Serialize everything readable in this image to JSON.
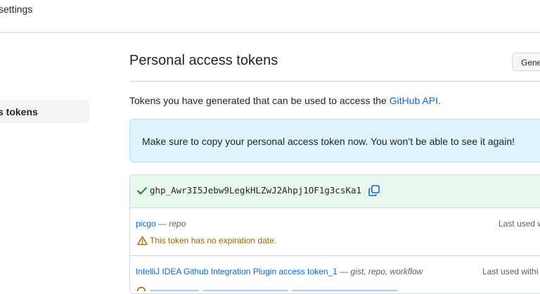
{
  "topbar": {
    "crumb": "settings"
  },
  "sidebar": {
    "active_item": "s tokens"
  },
  "page": {
    "title": "Personal access tokens",
    "generate_button": "Gene",
    "description_prefix": "Tokens you have generated that can be used to access the ",
    "description_link": "GitHub API",
    "description_suffix": "."
  },
  "flash": {
    "message": "Make sure to copy your personal access token now. You won’t be able to see it again!"
  },
  "new_token": {
    "value": "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"
  },
  "tokens": [
    {
      "name": "picgo",
      "scopes": " — repo",
      "last_used": "Last used w",
      "warning": "This token has no expiration date."
    },
    {
      "name": "IntelliJ IDEA Github Integration Plugin access token_1",
      "scopes": " — gist, repo, workflow",
      "last_used": "Last used withi"
    }
  ],
  "colors": {
    "link": "#0969da",
    "flash_bg": "#ddf4ff",
    "success_bg": "#e9f7ec",
    "success_icon": "#1a7f37",
    "warning": "#9a6700"
  }
}
